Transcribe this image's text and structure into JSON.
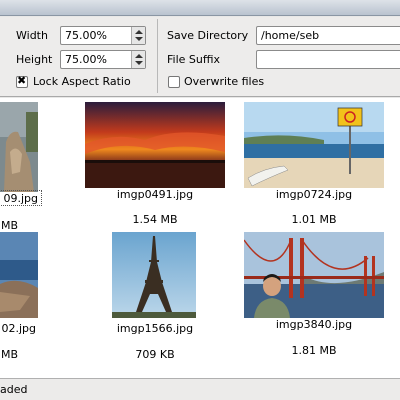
{
  "options": {
    "width_label": "Width",
    "width_value": "75.00%",
    "height_label": "Height",
    "height_value": "75.00%",
    "lock_aspect_label": "Lock Aspect Ratio",
    "lock_aspect_checked": true,
    "save_directory_label": "Save Directory",
    "save_directory_value": "/home/seb",
    "file_suffix_label": "File Suffix",
    "file_suffix_value": "",
    "overwrite_label": "Overwrite files",
    "overwrite_checked": false
  },
  "thumbnails": [
    {
      "name": "09.jpg",
      "size": "MB"
    },
    {
      "name": "imgp0491.jpg",
      "size": "1.54 MB"
    },
    {
      "name": "imgp0724.jpg",
      "size": "1.01 MB"
    },
    {
      "name": "02.jpg",
      "size": "MB"
    },
    {
      "name": "imgp1566.jpg",
      "size": "709 KB"
    },
    {
      "name": "imgp3840.jpg",
      "size": "1.81 MB"
    }
  ],
  "status": {
    "text": "aded"
  }
}
